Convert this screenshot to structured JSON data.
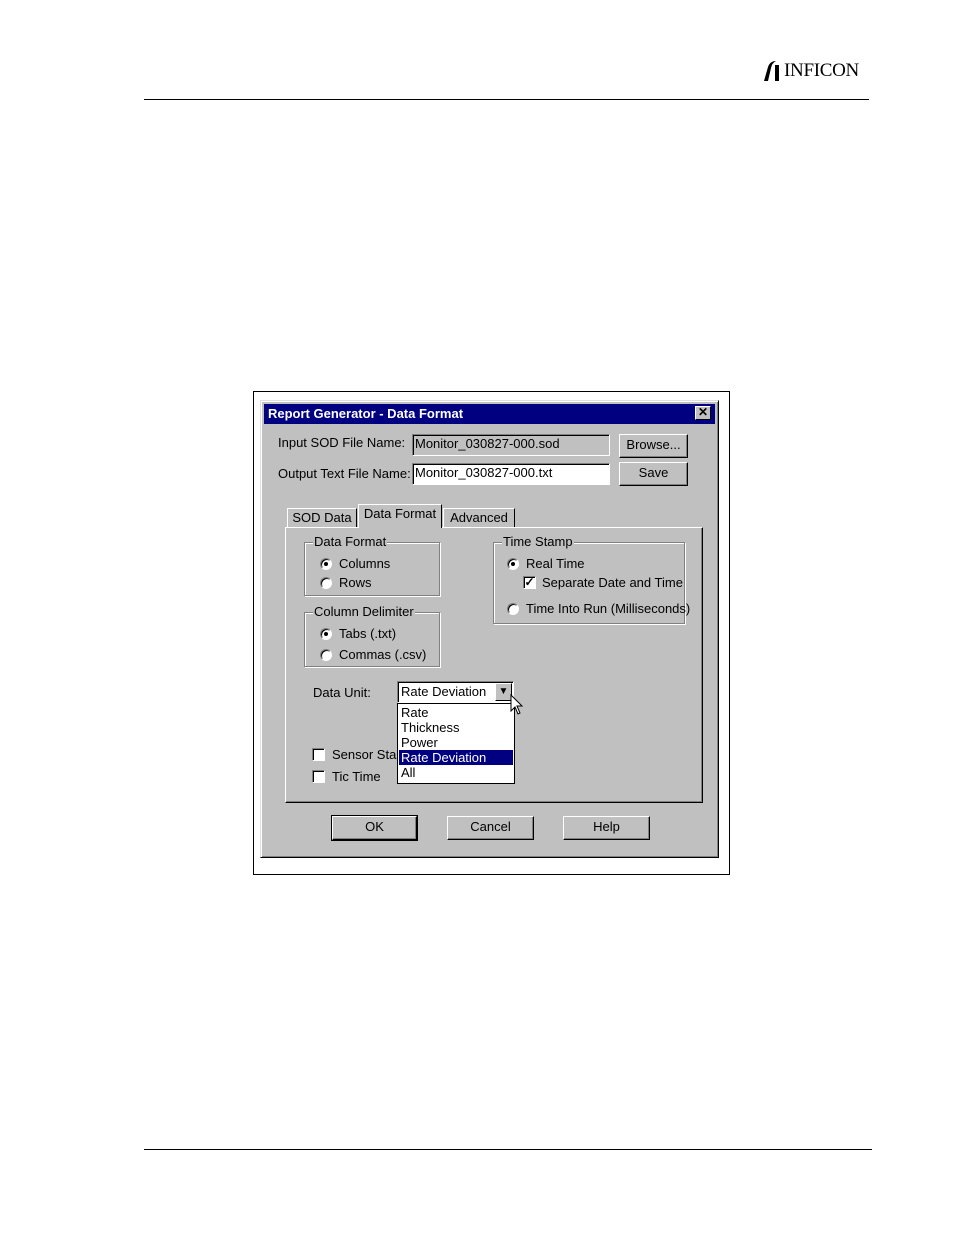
{
  "brand": {
    "logo_text": "INFICON"
  },
  "dialog": {
    "title": "Report Generator - Data Format",
    "input_label": "Input SOD File Name:",
    "input_value": "Monitor_030827-000.sod",
    "browse_label": "Browse...",
    "output_label": "Output Text File Name:",
    "output_value": "Monitor_030827-000.txt",
    "save_label": "Save",
    "tabs": [
      {
        "label": "SOD Data"
      },
      {
        "label": "Data Format"
      },
      {
        "label": "Advanced"
      }
    ],
    "active_tab": "Data Format",
    "data_format": {
      "title": "Data Format",
      "options": [
        {
          "label": "Columns",
          "selected": true
        },
        {
          "label": "Rows",
          "selected": false
        }
      ]
    },
    "column_delimiter": {
      "title": "Column Delimiter",
      "options": [
        {
          "label": "Tabs (.txt)",
          "selected": true
        },
        {
          "label": "Commas (.csv)",
          "selected": false
        }
      ]
    },
    "time_stamp": {
      "title": "Time Stamp",
      "real_time": "Real Time",
      "separate": "Separate Date and Time",
      "into_run": "Time Into Run (Milliseconds)"
    },
    "data_unit": {
      "label": "Data Unit:",
      "value": "Rate Deviation",
      "options": [
        "Rate",
        "Thickness",
        "Power",
        "Rate Deviation",
        "All"
      ],
      "selected_option": "Rate Deviation"
    },
    "sensor_status": "Sensor Sta",
    "tic_time": "Tic Time",
    "ok_label": "OK",
    "cancel_label": "Cancel",
    "help_label": "Help"
  }
}
